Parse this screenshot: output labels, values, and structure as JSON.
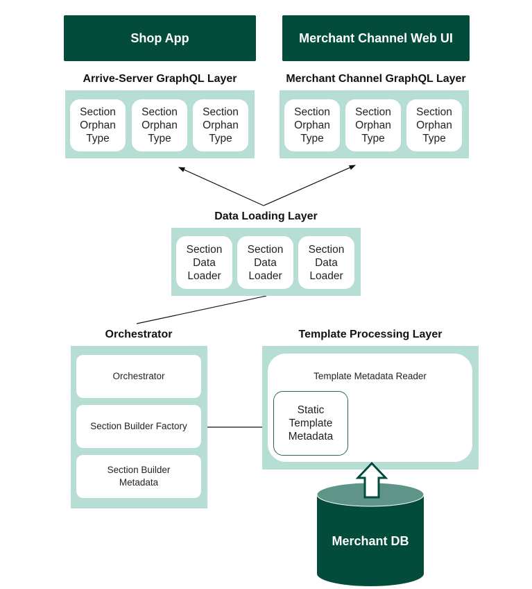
{
  "clients": {
    "shop_app": "Shop App",
    "merchant_web_ui": "Merchant Channel Web UI"
  },
  "arrive_server_layer": {
    "title": "Arrive-Server GraphQL Layer",
    "items": [
      "Section\nOrphan\nType",
      "Section\nOrphan\nType",
      "Section\nOrphan\nType"
    ]
  },
  "merchant_channel_layer": {
    "title": "Merchant Channel GraphQL Layer",
    "items": [
      "Section\nOrphan\nType",
      "Section\nOrphan\nType",
      "Section\nOrphan\nType"
    ]
  },
  "data_loading_layer": {
    "title": "Data Loading Layer",
    "items": [
      "Section\nData\nLoader",
      "Section\nData\nLoader",
      "Section\nData\nLoader"
    ]
  },
  "orchestrator_layer": {
    "title": "Orchestrator",
    "items": [
      "Orchestrator",
      "Section Builder Factory",
      "Section Builder\nMetadata"
    ]
  },
  "template_processing_layer": {
    "title": "Template Processing Layer",
    "reader": "Template Metadata Reader",
    "static_metadata": "Static\nTemplate\nMetadata"
  },
  "database": {
    "label": "Merchant DB"
  },
  "colors": {
    "dark_green": "#034c3c",
    "light_teal": "#b7ded5",
    "db_top": "#5f9488"
  }
}
